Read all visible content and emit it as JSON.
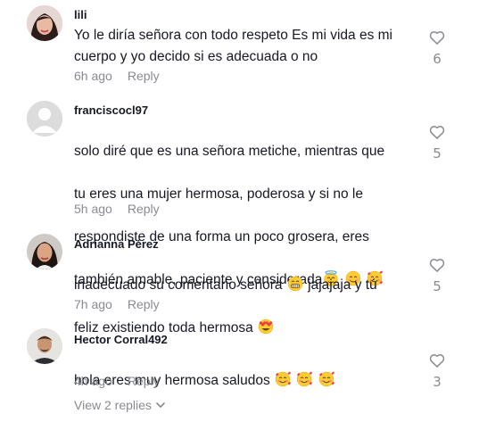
{
  "comments": [
    {
      "username": "lili",
      "text": "Yo le diría señora con todo respeto Es mi vida es mi\ncuerpo y yo decido si es adecuada o no",
      "time": "6h ago",
      "reply": "Reply",
      "likes": "6"
    },
    {
      "username": "franciscocl97",
      "text_lines": [
        "solo diré que es una señora metiche, mientras que",
        "tu eres una mujer hermosa, poderosa y si no le",
        "respondiste de una forma un poco grosera, eres",
        "también amable, paciente y considerada"
      ],
      "time": "5h ago",
      "reply": "Reply",
      "likes": "5",
      "emojis": [
        "smiling-face-with-halo",
        "smiling-face-with-smiling-eyes",
        "smiling-face-with-hearts"
      ]
    },
    {
      "username": "Adrianna Pérez",
      "line1_before": "inadecuado su comentario señora ",
      "line1_after": " jajajaja y tú",
      "line2": "feliz existiendo toda hermosa ",
      "time": "7h ago",
      "reply": "Reply",
      "likes": "5",
      "emojis": [
        "beaming-face-with-smiling-eyes",
        "smiling-face-with-heart-eyes"
      ]
    },
    {
      "username": "Hector Corral492",
      "text": "hola eres muy hermosa saludos ",
      "time": "4h ago",
      "reply": "Reply",
      "likes": "3",
      "emojis": [
        "smiling-face-with-hearts",
        "smiling-face-with-hearts",
        "smiling-face-with-hearts"
      ]
    }
  ],
  "view_replies": "View 2 replies",
  "colors": {
    "text": "#161823",
    "muted": "#8a8b91",
    "emoji_yellow": "#ffcc33",
    "heart_red": "#ef3b47"
  }
}
